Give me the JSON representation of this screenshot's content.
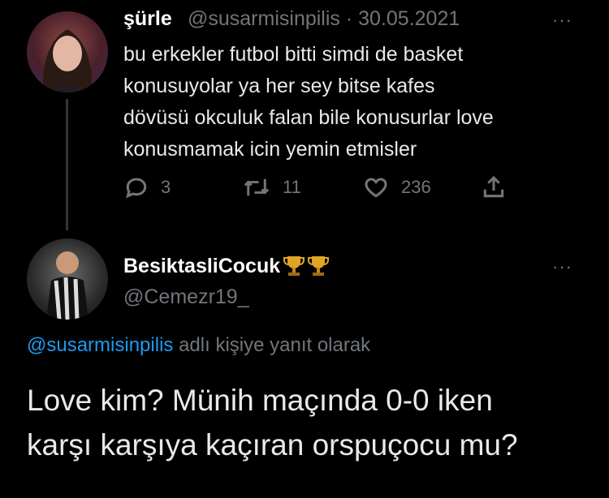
{
  "tweet": {
    "display_name": "şürle",
    "handle_date": "@susarmisinpilis · 30.05.2021",
    "text": "bu erkekler futbol bitti simdi de basket\nkonusuyolar ya her sey bitse kafes\ndövüsü okculuk falan bile konusurlar love\nkonusmamak icin yemin etmisler",
    "more": "···",
    "replies": "3",
    "retweets": "11",
    "likes": "236"
  },
  "reply": {
    "display_name": "BesiktasliCocuk",
    "badges": [
      "trophy-icon",
      "trophy-icon"
    ],
    "handle": "@Cemezr19_",
    "more": "···",
    "replying_to_mention": "@susarmisinpilis",
    "replying_to_suffix": " adlı kişiye yanıt olarak",
    "text": "Love kim? Münih maçında 0-0 iken\nkarşı karşıya kaçıran orspuçocu mu?"
  },
  "colors": {
    "background": "#000000",
    "text": "#e7e9ea",
    "muted": "#71767b",
    "accent": "#1d9bf0",
    "trophy": "#e0a526"
  }
}
